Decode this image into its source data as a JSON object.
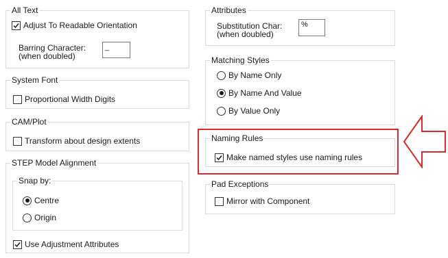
{
  "all_text": {
    "title": "All Text",
    "adjust_label": "Adjust To Readable Orientation",
    "adjust_checked": true,
    "barring_label_1": "Barring Character:",
    "barring_label_2": "(when doubled)",
    "barring_value": "_"
  },
  "system_font": {
    "title": "System Font",
    "proportional_label": "Proportional Width Digits",
    "proportional_checked": false
  },
  "cam_plot": {
    "title": "CAM/Plot",
    "transform_label": "Transform about design extents",
    "transform_checked": false
  },
  "step_model": {
    "title": "STEP Model Alignment",
    "snap_title": "Snap by:",
    "options": [
      "Centre",
      "Origin"
    ],
    "selected": "Centre",
    "use_adjustment_label": "Use Adjustment Attributes",
    "use_adjustment_checked": true
  },
  "attributes": {
    "title": "Attributes",
    "substitution_label_1": "Substitution Char:",
    "substitution_label_2": "(when doubled)",
    "substitution_value": "%"
  },
  "matching_styles": {
    "title": "Matching Styles",
    "options": [
      "By Name Only",
      "By Name And Value",
      "By Value Only"
    ],
    "selected": "By Name And Value"
  },
  "naming_rules": {
    "title": "Naming Rules",
    "make_named_label": "Make named styles use naming rules",
    "make_named_checked": true
  },
  "pad_exceptions": {
    "title": "Pad Exceptions",
    "mirror_label": "Mirror with Component",
    "mirror_checked": false
  },
  "annotation": {
    "highlight_color": "#e0282e"
  }
}
